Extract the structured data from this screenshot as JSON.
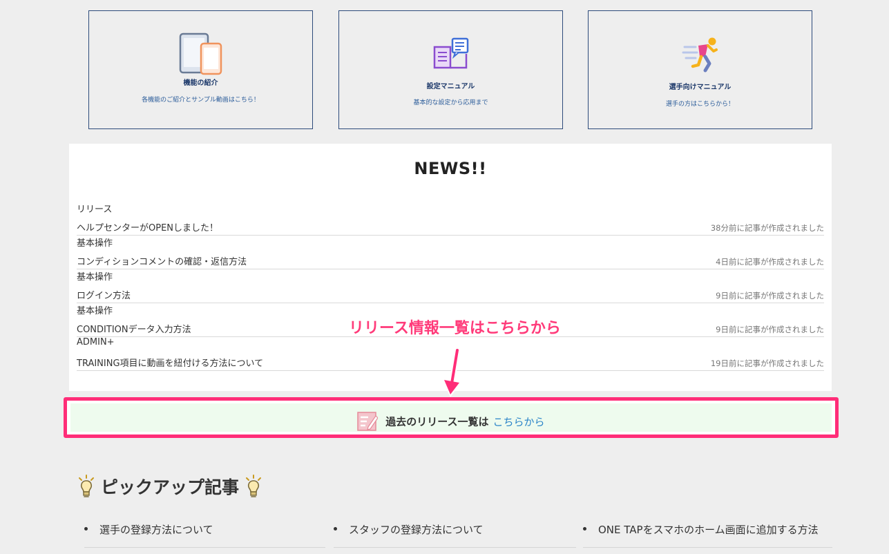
{
  "cards": [
    {
      "title": "機能の紹介",
      "subtitle": "各機能のご紹介とサンプル動画はこちら！",
      "icon": "devices-icon"
    },
    {
      "title": "設定マニュアル",
      "subtitle": "基本的な設定から応用まで",
      "icon": "manual-book-icon"
    },
    {
      "title": "選手向けマニュアル",
      "subtitle": "選手の方はこちらから！",
      "icon": "runner-icon"
    }
  ],
  "news": {
    "title": "NEWS!!",
    "items": [
      {
        "category": "リリース",
        "title": "ヘルプセンターがOPENしました！",
        "time": "38分前に記事が作成されました"
      },
      {
        "category": "基本操作",
        "title": "コンディションコメントの確認・返信方法",
        "time": "4日前に記事が作成されました"
      },
      {
        "category": "基本操作",
        "title": "ログイン方法",
        "time": "9日前に記事が作成されました"
      },
      {
        "category": "基本操作",
        "title": "CONDITIONデータ入力方法",
        "time": "9日前に記事が作成されました"
      },
      {
        "category": "ADMIN+",
        "title": "TRAINING項目に動画を紐付ける方法について",
        "time": "19日前に記事が作成されました"
      }
    ]
  },
  "annotation": {
    "text": "リリース情報一覧はこちらから",
    "color": "#ff3b7a"
  },
  "release_box": {
    "text": "過去のリリース一覧は",
    "link": "こちらから",
    "border_color": "#ff2d78",
    "link_color": "#2a84c8"
  },
  "pickup": {
    "title": "ピックアップ記事",
    "items": [
      "選手の登録方法について",
      "スタッフの登録方法について",
      "ONE TAPをスマホのホーム画面に追加する方法"
    ]
  }
}
